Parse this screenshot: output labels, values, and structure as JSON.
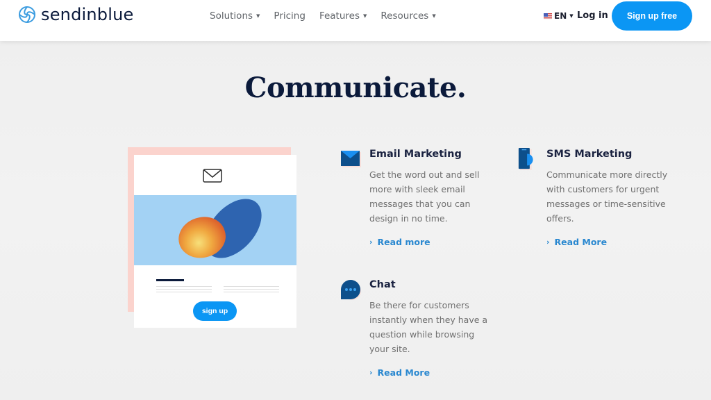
{
  "header": {
    "brand": "sendinblue",
    "nav": [
      {
        "label": "Solutions",
        "has_dropdown": true
      },
      {
        "label": "Pricing",
        "has_dropdown": false
      },
      {
        "label": "Features",
        "has_dropdown": true
      },
      {
        "label": "Resources",
        "has_dropdown": true
      }
    ],
    "language": "EN",
    "login_label": "Log in",
    "signup_label": "Sign up free",
    "caret": "▼"
  },
  "main": {
    "title": "Communicate.",
    "illustration": {
      "button_label": "sign up"
    },
    "features": [
      {
        "icon": "email-icon",
        "title": "Email Marketing",
        "description": "Get the word out and sell more with sleek email messages that you can design in no time.",
        "link_label": "Read more"
      },
      {
        "icon": "sms-icon",
        "title": "SMS Marketing",
        "description": "Communicate more directly with customers for urgent messages or time-sensitive offers.",
        "link_label": "Read More"
      },
      {
        "icon": "chat-icon",
        "title": "Chat",
        "description": "Be there for customers instantly when they have a question while browsing your site.",
        "link_label": "Read More"
      }
    ],
    "chevron": "›"
  },
  "colors": {
    "brand_dark": "#0b1a3b",
    "accent_blue": "#0b96f4",
    "link_blue": "#2a88d0",
    "icon_navy": "#0d4f8b"
  }
}
